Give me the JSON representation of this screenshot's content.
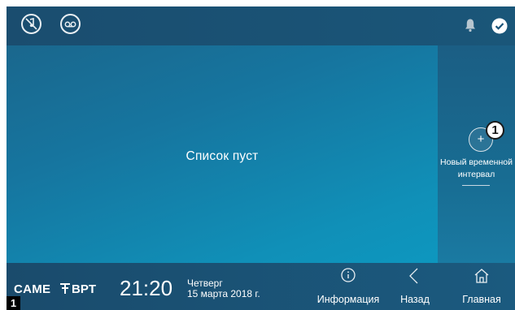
{
  "topbar": {
    "left_icons": [
      "mute-ringtone-icon",
      "voicemail-icon"
    ],
    "right_icons": [
      "bell-icon",
      "check-icon"
    ]
  },
  "main": {
    "empty_message": "Список пуст"
  },
  "side_panel": {
    "add_button_symbol": "+",
    "marker_number": "1",
    "add_label": "Новый временной интервал"
  },
  "bottombar": {
    "brand_left": "CAME",
    "brand_right": "BPT",
    "time": "21:20",
    "day": "Четверг",
    "date": "15 марта 2018 г.",
    "info_label": "Информация",
    "back_label": "Назад",
    "home_label": "Главная"
  },
  "corner_badge": "1",
  "colors": {
    "accent": "#1597c3",
    "bar": "#1a5379",
    "text": "#ffffff"
  }
}
